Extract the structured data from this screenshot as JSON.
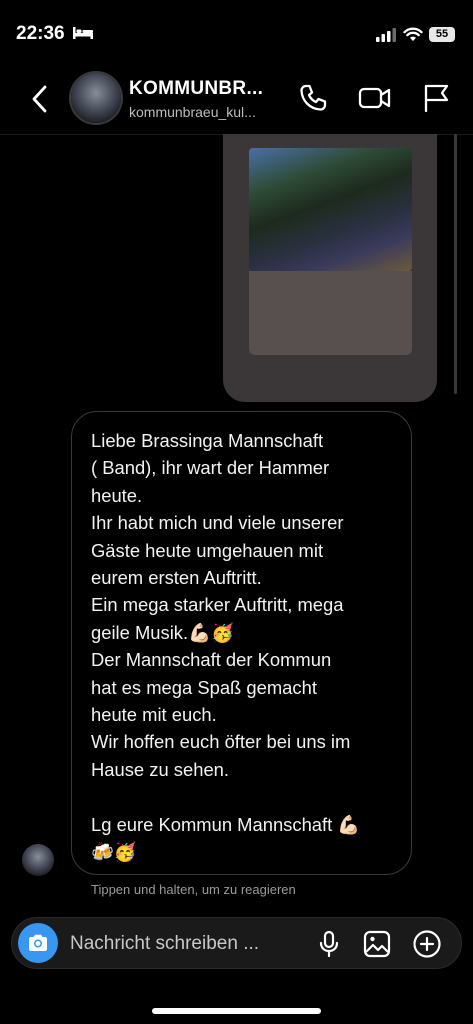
{
  "status_bar": {
    "time": "22:36",
    "battery_level": "55",
    "icons": [
      "bed-icon",
      "cellular-signal-icon",
      "wifi-icon",
      "battery-icon"
    ]
  },
  "header": {
    "title": "KOMMUNBR...",
    "username": "kommunbraeu_kul...",
    "icons": [
      "back-chevron-icon",
      "phone-icon",
      "video-camera-icon",
      "flag-icon"
    ]
  },
  "messages": {
    "received_text": "Liebe Brassinga Mannschaft\n( Band), ihr  wart der Hammer\nheute.\nIhr habt mich und viele unserer\nGäste heute umgehauen mit\neurem  ersten Auftritt.\nEin mega  starker Auftritt, mega\ngeile Musik.💪🏻🥳\nDer Mannschaft  der Kommun\nhat es mega Spaß gemacht\nheute mit  euch.\nWir hoffen euch öfter bei uns im\nHause zu sehen.\n\nLg eure Kommun Mannschaft 💪🏻\n🍻🥳",
    "reaction_hint": "Tippen und halten, um zu reagieren"
  },
  "composer": {
    "placeholder": "Nachricht schreiben ...",
    "icons": [
      "camera-icon",
      "microphone-icon",
      "gallery-icon",
      "plus-circle-icon"
    ]
  },
  "colors": {
    "background": "#000000",
    "camera_button": "#3897f0",
    "media_bubble": "#3b3738",
    "composer_bg": "#1a1a1a"
  }
}
